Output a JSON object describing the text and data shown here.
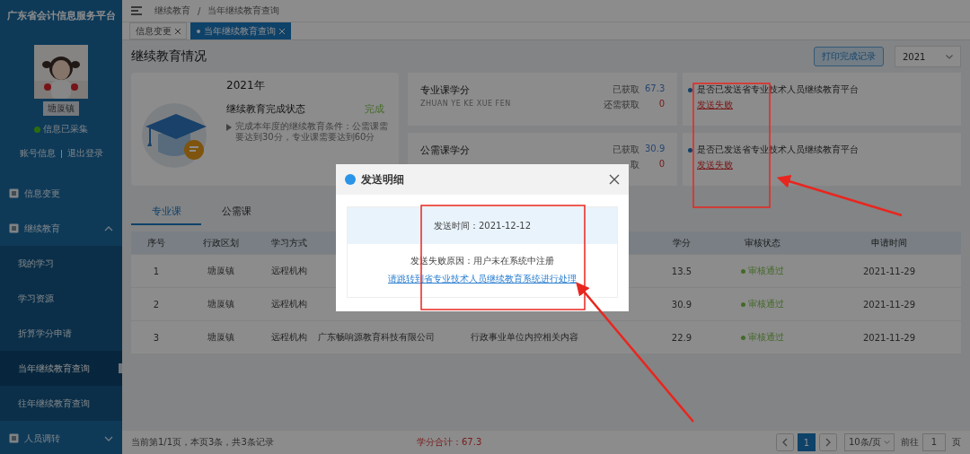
{
  "sidebar": {
    "logo": "广东省会计信息服务平台",
    "avatar": {
      "kind": "picture"
    },
    "user_name": "塘厦镇",
    "info_status": "信息已采集",
    "links": [
      "账号信息",
      "退出登录"
    ],
    "menu": [
      {
        "label": "信息变更",
        "kind": "link"
      },
      {
        "label": "继续教育",
        "kind": "group",
        "expanded": true,
        "children": [
          {
            "label": "我的学习",
            "selected": false
          },
          {
            "label": "学习资源",
            "selected": false
          },
          {
            "label": "折算学分申请",
            "selected": false
          },
          {
            "label": "当年继续教育查询",
            "selected": true
          },
          {
            "label": "往年继续教育查询",
            "selected": false
          }
        ]
      },
      {
        "label": "人员调转",
        "kind": "group",
        "expanded": false
      }
    ]
  },
  "breadcrumb": [
    "继续教育",
    "当年继续教育查询"
  ],
  "breadcrumb_separator": "/",
  "tabs": [
    {
      "label": "信息变更",
      "selected": false
    },
    {
      "label": "当年继续教育查询",
      "selected": true
    }
  ],
  "page_title": "继续教育情况",
  "print_button": "打印完成记录",
  "year_select": "2021",
  "summary": {
    "year": "2021年",
    "status_label": "继续教育完成状态",
    "status": "完成",
    "note": "完成本年度的继续教育条件：公需课需要达到30分，专业课需要达到60分"
  },
  "credits": [
    {
      "title": "专业课学分",
      "subtitle": "ZHUAN YE KE XUE FEN",
      "earned_label": "已获取",
      "earned": "67.3",
      "remaining_label": "还需获取",
      "remaining": "0",
      "sync_label": "是否已发送省专业技术人员继续教育平台",
      "sync_status": "发送失败"
    },
    {
      "title": "公需课学分",
      "earned_label": "已获取",
      "earned": "30.9",
      "remaining_label": "取",
      "remaining": "0",
      "sync_label": "是否已发送省专业技术人员继续教育平台",
      "sync_status": "发送失败"
    }
  ],
  "course_tabs": [
    {
      "label": "专业课",
      "selected": true
    },
    {
      "label": "公需课",
      "selected": false
    }
  ],
  "table": {
    "columns": {
      "index": "序号",
      "region": "行政区划",
      "mode": "学习方式",
      "credit": "学分",
      "review": "审核状态",
      "date": "申请时间"
    },
    "rows": [
      {
        "index": "1",
        "region": "塘厦镇",
        "mode": "远程机构",
        "credit": "13.5",
        "review": "审核通过",
        "date": "2021-11-29"
      },
      {
        "index": "2",
        "region": "塘厦镇",
        "mode": "远程机构",
        "credit": "30.9",
        "review": "审核通过",
        "date": "2021-11-29"
      },
      {
        "index": "3",
        "region": "塘厦镇",
        "mode": "远程机构",
        "column_4": "广东畅响源教育科技有限公司",
        "column_5": "行政事业单位内控相关内容",
        "credit": "22.9",
        "review": "审核通过",
        "date": "2021-11-29"
      }
    ]
  },
  "footer": {
    "summary": "当前第1/1页，本页3条，共3条记录",
    "total": "学分合计：67.3",
    "pages": [
      {
        "label": "1",
        "selected": true
      }
    ],
    "page_size": "10条/页",
    "goto_label": "前往",
    "goto_value": "1",
    "goto_unit": "页"
  },
  "dialog": {
    "title": "发送明细",
    "send_time": "发送时间：2021-12-12",
    "reason": "发送失败原因：用户未在系统中注册",
    "link": "请跳转到省专业技术人员继续教育系统进行处理"
  }
}
